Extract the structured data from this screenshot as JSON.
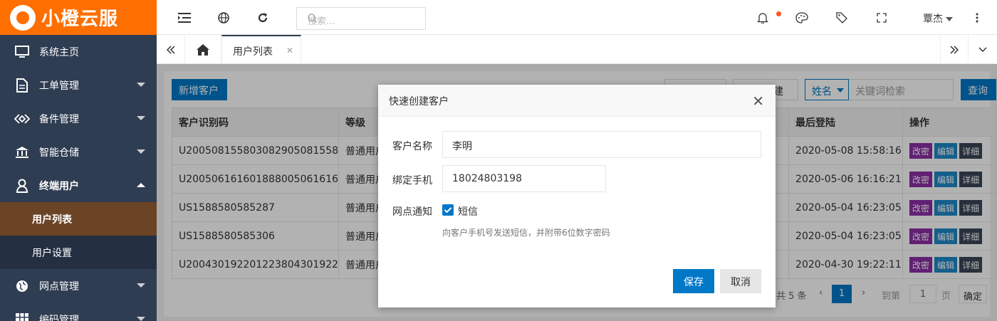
{
  "app": {
    "name": "小橙云服"
  },
  "sidebar": {
    "items": [
      {
        "label": "系统主页",
        "icon": "monitor-icon"
      },
      {
        "label": "工单管理",
        "icon": "document-icon"
      },
      {
        "label": "备件管理",
        "icon": "link-icon"
      },
      {
        "label": "智能仓储",
        "icon": "bank-icon"
      },
      {
        "label": "终端用户",
        "icon": "user-icon"
      },
      {
        "label": "网点管理",
        "icon": "globe-icon"
      },
      {
        "label": "编码管理",
        "icon": "grid-icon"
      }
    ],
    "sub_items": [
      {
        "label": "用户列表"
      },
      {
        "label": "用户设置"
      }
    ]
  },
  "header": {
    "search_placeholder": "搜索...",
    "username": "覃杰"
  },
  "tabs": [
    {
      "label": "用户列表"
    }
  ],
  "toolbar": {
    "add_label": "新增客户",
    "filter_fragment": "建",
    "field_select": "姓名",
    "keyword_placeholder": "关键词检索",
    "query_label": "查询"
  },
  "table": {
    "columns": [
      "客户识别码",
      "等级",
      "最后登陆",
      "操作"
    ],
    "rows": [
      {
        "id": "U20050815580308290508155 8",
        "level": "普通用户",
        "last": "2020-05-08 15:58:16"
      },
      {
        "id": "U20050616160188800506161 6",
        "level": "普通用户",
        "last": "2020-05-06 16:16:21"
      },
      {
        "id": "US1588580585287",
        "level": "普通用户",
        "last": "2020-05-04 16:23:05"
      },
      {
        "id": "US1588580585306",
        "level": "普通用户",
        "last": "2020-05-04 16:23:05"
      },
      {
        "id": "U20043019220122380430192 2",
        "level": "普通用户",
        "last": "2020-04-30 19:22:11"
      }
    ],
    "actions": {
      "reset": "改密",
      "edit": "编辑",
      "detail": "详细"
    }
  },
  "pager": {
    "total": "共 5 条",
    "current": "1",
    "goto": "到第",
    "page_input": "1",
    "unit": "页",
    "confirm": "确定"
  },
  "modal": {
    "title": "快速创建客户",
    "name_label": "客户名称",
    "name_value": "李明",
    "phone_label": "绑定手机",
    "phone_value": "18024803198",
    "notify_label": "网点通知",
    "sms_label": "短信",
    "hint": "向客户手机号发送短信，并附带6位数字密码",
    "save": "保存",
    "cancel": "取消"
  }
}
